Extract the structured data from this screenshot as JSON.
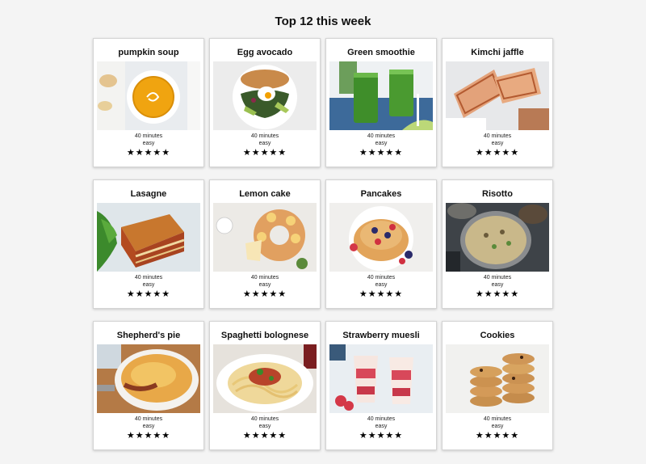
{
  "page": {
    "title": "Top 12 this week"
  },
  "recipes": [
    {
      "name": "pumpkin soup",
      "time": "40 minutes",
      "difficulty": "easy",
      "rating": 5,
      "image": "pumpkin-soup-photo"
    },
    {
      "name": "Egg avocado",
      "time": "40 minutes",
      "difficulty": "easy",
      "rating": 5,
      "image": "egg-avocado-photo"
    },
    {
      "name": "Green smoothie",
      "time": "40 minutes",
      "difficulty": "easy",
      "rating": 5,
      "image": "green-smoothie-photo"
    },
    {
      "name": "Kimchi jaffle",
      "time": "40 minutes",
      "difficulty": "easy",
      "rating": 5,
      "image": "kimchi-jaffle-photo"
    },
    {
      "name": "Lasagne",
      "time": "40 minutes",
      "difficulty": "easy",
      "rating": 5,
      "image": "lasagne-photo"
    },
    {
      "name": "Lemon cake",
      "time": "40 minutes",
      "difficulty": "easy",
      "rating": 5,
      "image": "lemon-cake-photo"
    },
    {
      "name": "Pancakes",
      "time": "40 minutes",
      "difficulty": "easy",
      "rating": 5,
      "image": "pancakes-photo"
    },
    {
      "name": "Risotto",
      "time": "40 minutes",
      "difficulty": "easy",
      "rating": 5,
      "image": "risotto-photo"
    },
    {
      "name": "Shepherd's pie",
      "time": "40 minutes",
      "difficulty": "easy",
      "rating": 5,
      "image": "shepherds-pie-photo"
    },
    {
      "name": "Spaghetti bolognese",
      "time": "40 minutes",
      "difficulty": "easy",
      "rating": 5,
      "image": "spaghetti-bolognese-photo"
    },
    {
      "name": "Strawberry muesli",
      "time": "40 minutes",
      "difficulty": "easy",
      "rating": 5,
      "image": "strawberry-muesli-photo"
    },
    {
      "name": "Cookies",
      "time": "40 minutes",
      "difficulty": "easy",
      "rating": 5,
      "image": "cookies-photo"
    }
  ],
  "colors": {
    "background": "#f4f4f4",
    "card": "#ffffff",
    "border": "#d4d4d4",
    "star": "#000000"
  }
}
